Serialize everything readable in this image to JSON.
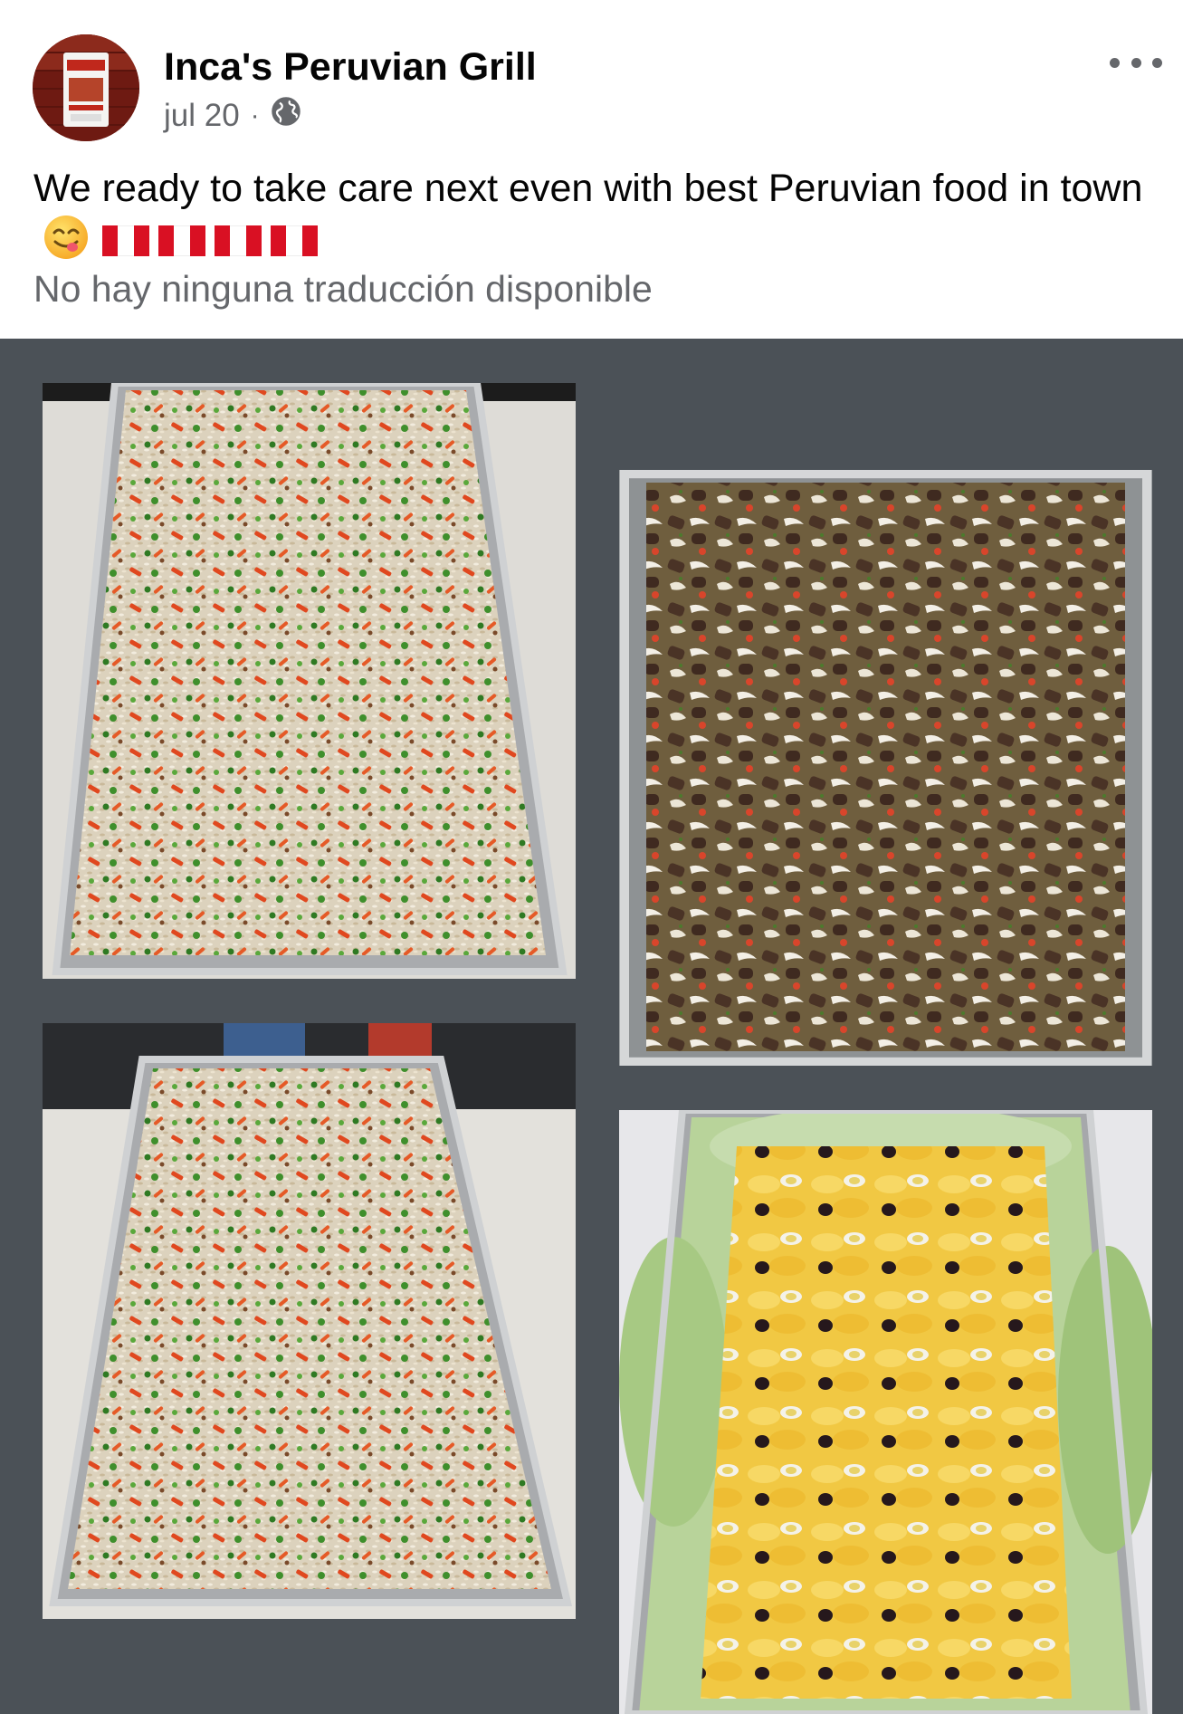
{
  "post": {
    "page_name": "Inca's Peruvian Grill",
    "date": "jul 20",
    "separator": "·",
    "audience_icon": "globe-icon",
    "more_icon": "more-options-icon",
    "text": "We ready to take care next even with best Peruvian food in town",
    "emoji": "yum-face-emoji",
    "flags": [
      "peru-flag",
      "peru-flag",
      "peru-flag",
      "peru-flag"
    ],
    "translation_note": "No hay ninguna traducción disponible"
  },
  "photos": [
    {
      "name": "photo-fried-rice-tray-1",
      "alt": "chaufa fried rice tray"
    },
    {
      "name": "photo-lomo-saltado-tray",
      "alt": "lomo saltado tray"
    },
    {
      "name": "photo-fried-rice-tray-2",
      "alt": "chaufa fried rice tray"
    },
    {
      "name": "photo-papa-a-la-huancaina-tray",
      "alt": "papa a la huancaina tray"
    }
  ],
  "colors": {
    "text_primary": "#050505",
    "text_secondary": "#65676b",
    "gallery_background": "#4b5157"
  }
}
